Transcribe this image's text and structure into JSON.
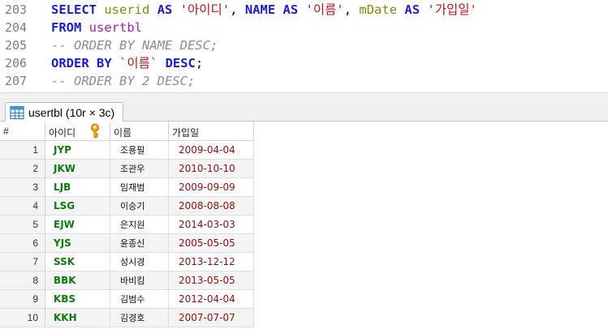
{
  "editor": {
    "lines": [
      {
        "no": "203",
        "tokens": [
          {
            "t": "SELECT",
            "c": "kw"
          },
          {
            "t": " ",
            "c": "pl"
          },
          {
            "t": "userid",
            "c": "idf"
          },
          {
            "t": " ",
            "c": "pl"
          },
          {
            "t": "AS",
            "c": "kw"
          },
          {
            "t": " ",
            "c": "pl"
          },
          {
            "t": "'아이디'",
            "c": "str"
          },
          {
            "t": ", ",
            "c": "pl"
          },
          {
            "t": "NAME",
            "c": "kw"
          },
          {
            "t": " ",
            "c": "pl"
          },
          {
            "t": "AS",
            "c": "kw"
          },
          {
            "t": " ",
            "c": "pl"
          },
          {
            "t": "'이름'",
            "c": "str"
          },
          {
            "t": ", ",
            "c": "pl"
          },
          {
            "t": "mDate",
            "c": "idf"
          },
          {
            "t": " ",
            "c": "pl"
          },
          {
            "t": "AS",
            "c": "kw"
          },
          {
            "t": " ",
            "c": "pl"
          },
          {
            "t": "'가입일'",
            "c": "str"
          }
        ]
      },
      {
        "no": "204",
        "tokens": [
          {
            "t": "FROM",
            "c": "kw"
          },
          {
            "t": " ",
            "c": "pl"
          },
          {
            "t": "usertbl",
            "c": "fn"
          }
        ]
      },
      {
        "no": "205",
        "tokens": [
          {
            "t": "-- ORDER BY NAME DESC;",
            "c": "cmt"
          }
        ]
      },
      {
        "no": "206",
        "tokens": [
          {
            "t": "ORDER",
            "c": "kw"
          },
          {
            "t": " ",
            "c": "pl"
          },
          {
            "t": "BY",
            "c": "kw"
          },
          {
            "t": " ",
            "c": "pl"
          },
          {
            "t": "`이름`",
            "c": "str"
          },
          {
            "t": " ",
            "c": "pl"
          },
          {
            "t": "DESC",
            "c": "kw"
          },
          {
            "t": ";",
            "c": "pl"
          }
        ]
      },
      {
        "no": "207",
        "tokens": [
          {
            "t": "-- ORDER BY 2 DESC;",
            "c": "cmt"
          }
        ]
      }
    ]
  },
  "result_tab": {
    "label": "usertbl (10r × 3c)",
    "icon": "table-grid-icon"
  },
  "grid": {
    "row_header_label": "#",
    "columns": [
      {
        "label": "아이디",
        "key_icon": "primary-key-icon"
      },
      {
        "label": "이름"
      },
      {
        "label": "가입일"
      }
    ],
    "rows": [
      {
        "num": "1",
        "id": "JYP",
        "name": "조용필",
        "date": "2009-04-04"
      },
      {
        "num": "2",
        "id": "JKW",
        "name": "조관우",
        "date": "2010-10-10"
      },
      {
        "num": "3",
        "id": "LJB",
        "name": "임재범",
        "date": "2009-09-09"
      },
      {
        "num": "4",
        "id": "LSG",
        "name": "이승기",
        "date": "2008-08-08"
      },
      {
        "num": "5",
        "id": "EJW",
        "name": "은지원",
        "date": "2014-03-03"
      },
      {
        "num": "6",
        "id": "YJS",
        "name": "윤종신",
        "date": "2005-05-05"
      },
      {
        "num": "7",
        "id": "SSK",
        "name": "성시경",
        "date": "2013-12-12"
      },
      {
        "num": "8",
        "id": "BBK",
        "name": "바비킴",
        "date": "2013-05-05"
      },
      {
        "num": "9",
        "id": "KBS",
        "name": "김범수",
        "date": "2012-04-04"
      },
      {
        "num": "10",
        "id": "KKH",
        "name": "김경호",
        "date": "2007-07-07"
      }
    ]
  },
  "colors": {
    "keyword": "#1c1ccc",
    "identifier": "#8a8a00",
    "string": "#b51a1a",
    "table_name": "#a41ea4",
    "comment": "#8c8c8c",
    "id_value": "#0e7a0e",
    "date_value": "#8b1010"
  }
}
